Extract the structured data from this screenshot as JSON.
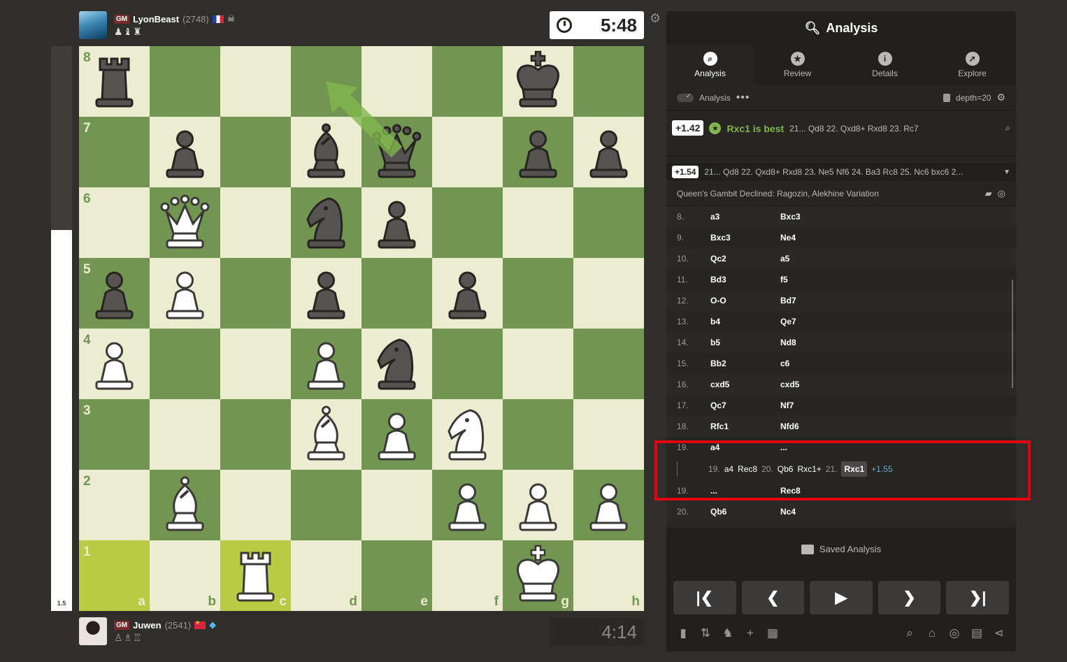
{
  "top_player": {
    "title": "GM",
    "name": "LyonBeast",
    "rating": "(2748)",
    "flag": "France",
    "status_icon": "skull-icon",
    "captured": "♟♝♜",
    "clock": "5:48"
  },
  "bottom_player": {
    "title": "GM",
    "name": "Juwen",
    "rating": "(2541)",
    "flag": "China",
    "status_icon": "diamond-icon",
    "captured": "♙♗♖",
    "clock": "4:14"
  },
  "eval_bar": {
    "label": "1.5",
    "black_fraction": 0.326
  },
  "board": {
    "orientation": "white",
    "ranks": [
      "8",
      "7",
      "6",
      "5",
      "4",
      "3",
      "2",
      "1"
    ],
    "files": [
      "a",
      "b",
      "c",
      "d",
      "e",
      "f",
      "g",
      "h"
    ],
    "highlighted_squares": [
      "a1",
      "c1"
    ],
    "arrow": {
      "from": "e7",
      "to": "d8",
      "color": "#81b64c"
    },
    "pieces": {
      "a8": "bR",
      "g8": "bK",
      "b7": "bP",
      "d7": "bB",
      "e7": "bQ",
      "g7": "bP",
      "h7": "bP",
      "b6": "wQ",
      "d6": "bN",
      "e6": "bP",
      "a5": "bP",
      "b5": "wP",
      "d5": "bP",
      "f5": "bP",
      "a4": "wP",
      "d4": "wP",
      "e4": "bN",
      "d3": "wB",
      "e3": "wP",
      "f3": "wN",
      "b2": "wB",
      "f2": "wP",
      "g2": "wP",
      "h2": "wP",
      "c1": "wR",
      "g1": "wK"
    }
  },
  "panel": {
    "title": "Analysis",
    "tabs": [
      {
        "label": "Analysis",
        "icon": "magnifier-icon",
        "active": true
      },
      {
        "label": "Review",
        "icon": "star-icon",
        "active": false
      },
      {
        "label": "Details",
        "icon": "info-icon",
        "active": false
      },
      {
        "label": "Explore",
        "icon": "compass-icon",
        "active": false
      }
    ],
    "toolbar": {
      "analysis_label": "Analysis",
      "depth": "depth=20"
    },
    "best": {
      "eval": "+1.42",
      "text": "Rxc1 is best",
      "line": "21... Qd8 22. Qxd8+ Rxd8 23. Rc7"
    },
    "engine_line": {
      "eval": "+1.54",
      "line": "21... Qd8 22. Qxd8+ Rxd8 23. Ne5 Nf6 24. Ba3 Rc8 25. Nc6 bxc6 2..."
    },
    "opening": "Queen's Gambit Declined: Ragozin, Alekhine Variation",
    "moves": [
      {
        "n": "8.",
        "w": "a3",
        "b": "Bxc3"
      },
      {
        "n": "9.",
        "w": "Bxc3",
        "b": "Ne4"
      },
      {
        "n": "10.",
        "w": "Qc2",
        "b": "a5"
      },
      {
        "n": "11.",
        "w": "Bd3",
        "b": "f5"
      },
      {
        "n": "12.",
        "w": "O-O",
        "b": "Bd7"
      },
      {
        "n": "13.",
        "w": "b4",
        "b": "Qe7"
      },
      {
        "n": "14.",
        "w": "b5",
        "b": "Nd8"
      },
      {
        "n": "15.",
        "w": "Bb2",
        "b": "c6"
      },
      {
        "n": "16.",
        "w": "cxd5",
        "b": "cxd5"
      },
      {
        "n": "17.",
        "w": "Qc7",
        "b": "Nf7"
      },
      {
        "n": "18.",
        "w": "Rfc1",
        "b": "Nfd6"
      },
      {
        "n": "19.",
        "w": "a4",
        "b": "..."
      }
    ],
    "variation": {
      "n1": "19.",
      "m1": "a4",
      "m2": "Rec8",
      "n2": "20.",
      "m3": "Qb6",
      "m4": "Rxc1+",
      "n3": "21.",
      "sel": "Rxc1",
      "eval": "+1.55"
    },
    "moves_after": [
      {
        "n": "19.",
        "w": "...",
        "b": "Rec8"
      },
      {
        "n": "20.",
        "w": "Qb6",
        "b": "Nc4"
      }
    ],
    "saved_label": "Saved Analysis",
    "controls": [
      "first",
      "prev",
      "play",
      "next",
      "last"
    ]
  }
}
